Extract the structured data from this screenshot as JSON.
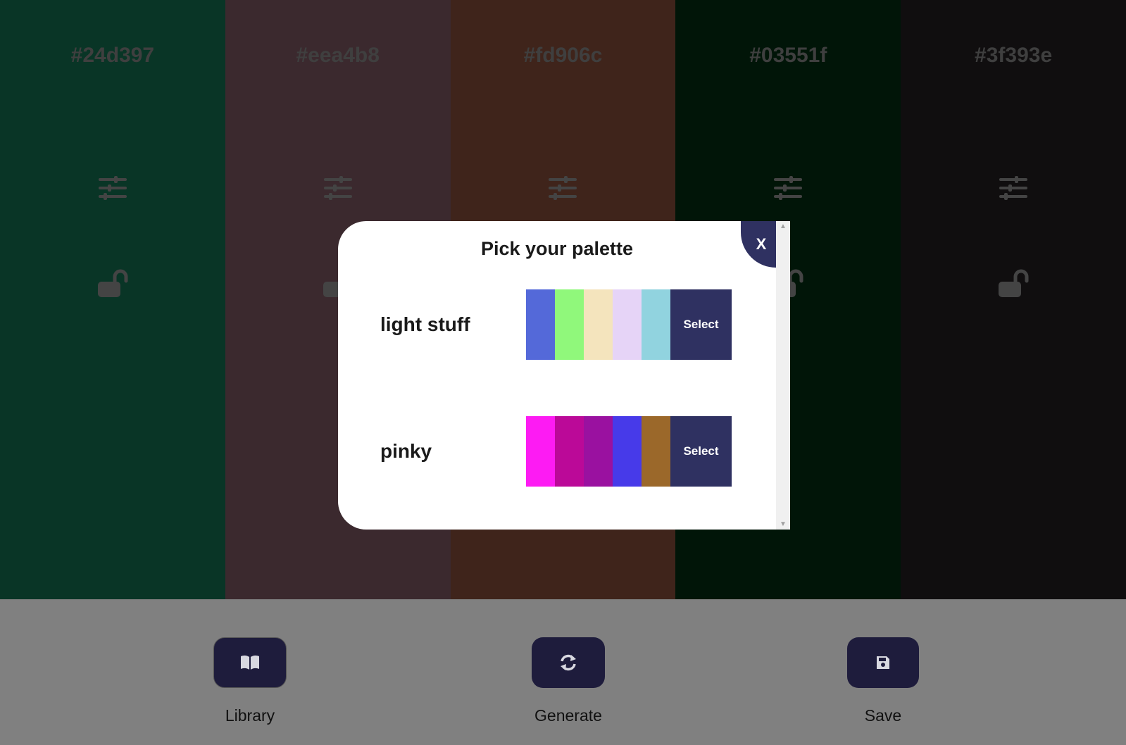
{
  "colors": [
    {
      "hex": "#24d397",
      "text_color": "#7f7f7f",
      "dimmed": "#126a4c",
      "icon_color": "#888888"
    },
    {
      "hex": "#eea4b8",
      "text_color": "#7f7f7f",
      "dimmed": "#77525c",
      "icon_color": "#888888"
    },
    {
      "hex": "#fd906c",
      "text_color": "#7f7f7f",
      "dimmed": "#7f4836",
      "icon_color": "#888888"
    },
    {
      "hex": "#03551f",
      "text_color": "#7f7f7f",
      "dimmed": "#022b10",
      "icon_color": "#888888"
    },
    {
      "hex": "#3f393e",
      "text_color": "#7f7f7f",
      "dimmed": "#201d1f",
      "icon_color": "#888888"
    }
  ],
  "modal": {
    "title": "Pick your palette",
    "close_label": "X",
    "palettes": [
      {
        "name": "light stuff",
        "colors": [
          "#5469d9",
          "#90f87b",
          "#f4e4bd",
          "#e6d4f7",
          "#91d3df"
        ],
        "select_label": "Select"
      },
      {
        "name": "pinky",
        "colors": [
          "#fd1bf3",
          "#bb0998",
          "#9a11a0",
          "#473ae9",
          "#9b682a"
        ],
        "select_label": "Select"
      }
    ]
  },
  "panel": {
    "library_label": "Library",
    "generate_label": "Generate",
    "save_label": "Save",
    "library_icon": "book-open-icon",
    "generate_icon": "sync-icon",
    "save_icon": "save-icon"
  }
}
